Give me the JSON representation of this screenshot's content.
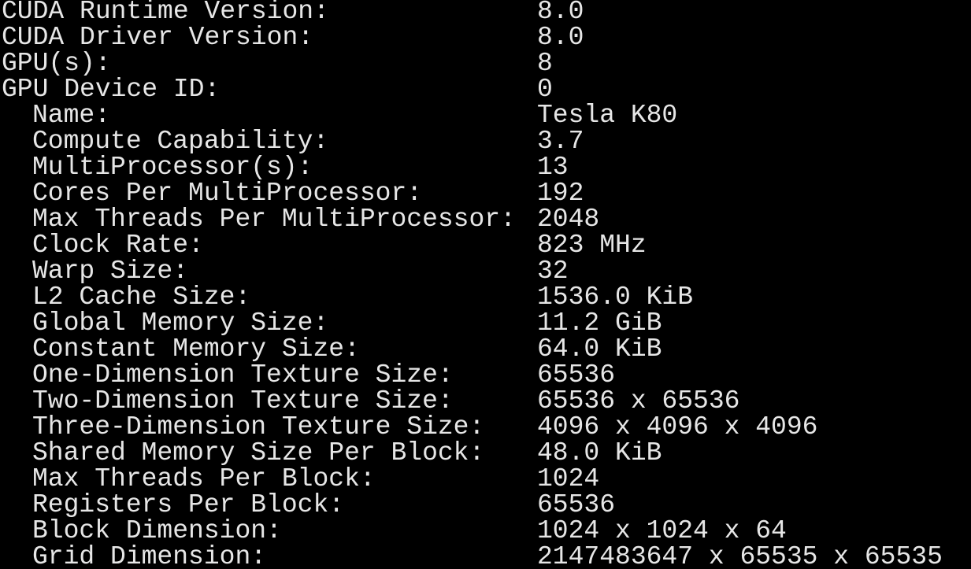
{
  "terminal": {
    "background": "#000000",
    "foreground": "#e6e6e6",
    "rows": [
      {
        "label": "CUDA Runtime Version:",
        "value": "8.0"
      },
      {
        "label": "CUDA Driver Version:",
        "value": "8.0"
      },
      {
        "label": "GPU(s):",
        "value": "8"
      },
      {
        "label": "GPU Device ID:",
        "value": "0"
      },
      {
        "label": "Name:",
        "value": "Tesla K80"
      },
      {
        "label": "Compute Capability:",
        "value": "3.7"
      },
      {
        "label": "MultiProcessor(s):",
        "value": "13"
      },
      {
        "label": "Cores Per MultiProcessor:",
        "value": "192"
      },
      {
        "label": "Max Threads Per MultiProcessor:",
        "value": "2048"
      },
      {
        "label": "Clock Rate:",
        "value": "823 MHz"
      },
      {
        "label": "Warp Size:",
        "value": "32"
      },
      {
        "label": "L2 Cache Size:",
        "value": "1536.0 KiB"
      },
      {
        "label": "Global Memory Size:",
        "value": "11.2 GiB"
      },
      {
        "label": "Constant Memory Size:",
        "value": "64.0 KiB"
      },
      {
        "label": "One-Dimension Texture Size:",
        "value": "65536"
      },
      {
        "label": "Two-Dimension Texture Size:",
        "value": "65536 x 65536"
      },
      {
        "label": "Three-Dimension Texture Size:",
        "value": "4096 x 4096 x 4096"
      },
      {
        "label": "Shared Memory Size Per Block:",
        "value": "48.0 KiB"
      },
      {
        "label": "Max Threads Per Block:",
        "value": "1024"
      },
      {
        "label": "Registers Per Block:",
        "value": "65536"
      },
      {
        "label": "Block Dimension:",
        "value": "1024 x 1024 x 64"
      },
      {
        "label": "Grid Dimension:",
        "value": "2147483647 x 65535 x 65535"
      }
    ]
  }
}
